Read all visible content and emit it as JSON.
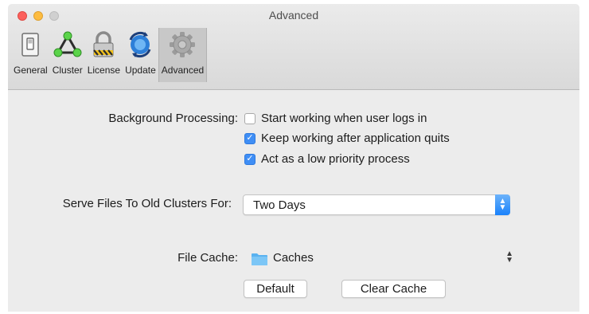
{
  "window": {
    "title": "Advanced"
  },
  "toolbar": {
    "items": [
      {
        "label": "General",
        "icon": "switch-icon"
      },
      {
        "label": "Cluster",
        "icon": "cluster-icon"
      },
      {
        "label": "License",
        "icon": "padlock-icon"
      },
      {
        "label": "Update",
        "icon": "globe-refresh-icon"
      },
      {
        "label": "Advanced",
        "icon": "gear-icon",
        "selected": true
      }
    ]
  },
  "background_processing": {
    "label": "Background Processing:",
    "options": [
      {
        "label": "Start working when user logs in",
        "checked": false
      },
      {
        "label": "Keep working after application quits",
        "checked": true
      },
      {
        "label": "Act as a low priority process",
        "checked": true
      }
    ]
  },
  "serve_files": {
    "label": "Serve Files To Old Clusters For:",
    "selected": "Two Days"
  },
  "file_cache": {
    "label": "File Cache:",
    "folder_name": "Caches",
    "default_label": "Default",
    "clear_label": "Clear Cache"
  },
  "colors": {
    "accent": "#3f8ef5",
    "close": "#fc605c",
    "minimize": "#fdbc40",
    "folder": "#5ab2f0"
  }
}
